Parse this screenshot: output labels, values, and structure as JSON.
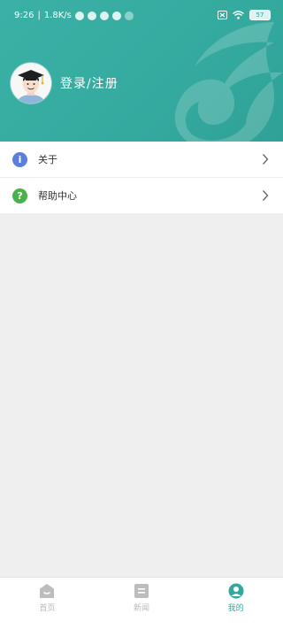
{
  "status_bar": {
    "time": "9:26",
    "network_speed": "1.8K/s",
    "battery": "57"
  },
  "profile": {
    "login_label": "登录/注册"
  },
  "menu": {
    "items": [
      {
        "label": "关于",
        "icon": "info-icon",
        "color": "#5b7fdc"
      },
      {
        "label": "帮助中心",
        "icon": "question-icon",
        "color": "#49b34b"
      }
    ]
  },
  "tabbar": {
    "tabs": [
      {
        "label": "首页",
        "icon": "home-icon",
        "active": false
      },
      {
        "label": "新闻",
        "icon": "news-icon",
        "active": false
      },
      {
        "label": "我的",
        "icon": "profile-icon",
        "active": true
      }
    ]
  },
  "colors": {
    "brand": "#35aba0",
    "active_tab": "#34a89d",
    "inactive_tab": "#b8b8b8",
    "background": "#efefef"
  }
}
